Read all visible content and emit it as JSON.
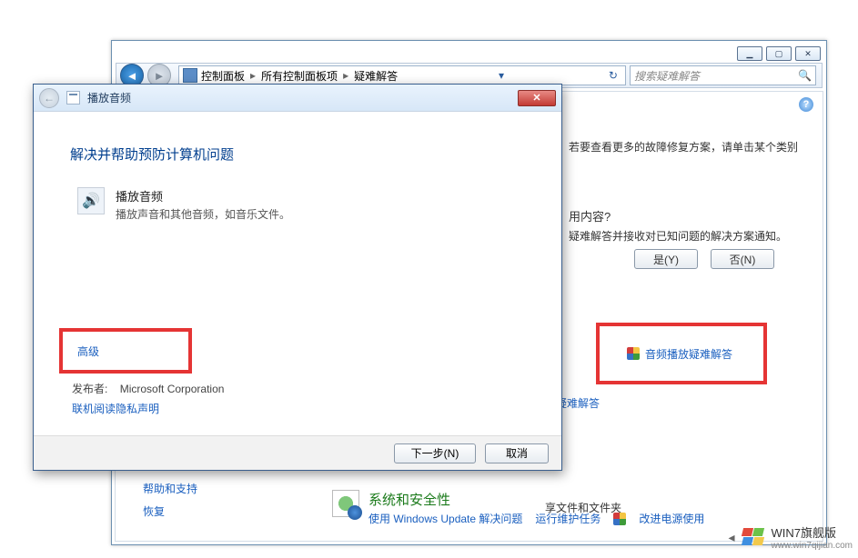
{
  "bg_window": {
    "caption": {
      "min": "▁",
      "max": "▢",
      "close": "✕"
    },
    "breadcrumbs": {
      "a": "控制面板",
      "b": "所有控制面板项",
      "c": "疑难解答"
    },
    "search_placeholder": "搜索疑难解答",
    "headline_partial": "若要查看更多的故障修复方案，请单击某个类别",
    "question_partial": "用内容?",
    "desc_partial": "疑难解答并接收对已知问题的解决方案通知。",
    "yes": "是(Y)",
    "no": "否(N)",
    "trunc_link": "刂疑难解答",
    "audio_troubleshoot": "音频播放疑难解答",
    "share_partial": "享文件和文件夹",
    "sidebar": {
      "help": "帮助和支持",
      "recovery": "恢复"
    },
    "syssec_title": "系统和安全性",
    "syssec_a": "使用 Windows Update 解决问题",
    "syssec_b": "运行维护任务",
    "syssec_c": "改进电源使用"
  },
  "wizard": {
    "title": "播放音频",
    "heading": "解决并帮助预防计算机问题",
    "item_title": "播放音频",
    "item_sub": "播放声音和其他音频，如音乐文件。",
    "advanced": "高级",
    "publisher_label": "发布者:",
    "publisher_value": "Microsoft Corporation",
    "privacy": "联机阅读隐私声明",
    "next": "下一步(N)",
    "cancel": "取消"
  },
  "branding": {
    "name": "WIN7旗舰版",
    "url": "www.win7qijian.com"
  }
}
